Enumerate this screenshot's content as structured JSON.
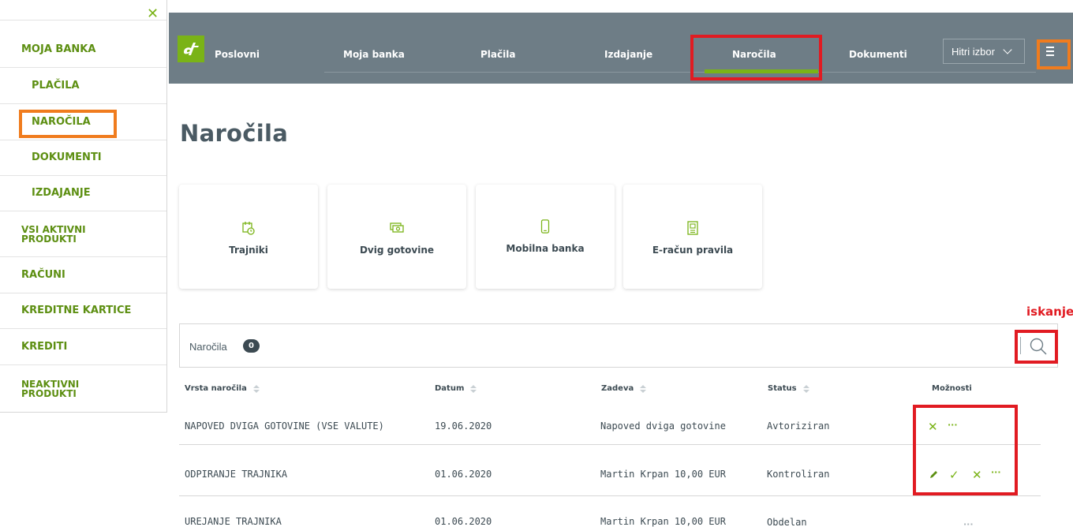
{
  "drawer": {
    "items": [
      {
        "label": "MOJA BANKA"
      },
      {
        "label": "PLAČILA"
      },
      {
        "label": "NAROČILA"
      },
      {
        "label": "DOKUMENTI"
      },
      {
        "label": "IZDAJANJE"
      },
      {
        "label_line1": "VSI AKTIVNI",
        "label_line2": "PRODUKTI"
      },
      {
        "label": "RAČUNI"
      },
      {
        "label": "KREDITNE KARTICE"
      },
      {
        "label": "KREDITI"
      },
      {
        "label_line1": "NEAKTIVNI",
        "label_line2": "PRODUKTI"
      }
    ]
  },
  "header": {
    "brand": "Poslovni",
    "nav": [
      "Moja banka",
      "Plačila",
      "Izdajanje",
      "Naročila",
      "Dokumenti"
    ],
    "active_nav": "Naročila",
    "quick_select": "Hitri izbor"
  },
  "page": {
    "title": "Naročila",
    "tiles": [
      {
        "label": "Trajniki",
        "icon": "calendar-clock-icon"
      },
      {
        "label": "Dvig gotovine",
        "icon": "cash-icon"
      },
      {
        "label": "Mobilna banka",
        "icon": "mobile-phone-icon"
      },
      {
        "label": "E-račun pravila",
        "icon": "document-rules-icon"
      }
    ],
    "search_annotation": "iskanje"
  },
  "orders": {
    "title": "Naročila",
    "count": "0",
    "columns": [
      "Vrsta naročila",
      "Datum",
      "Zadeva",
      "Status",
      "Možnosti"
    ],
    "rows": [
      {
        "type": "NAPOVED DVIGA GOTOVINE (VSE VALUTE)",
        "date": "19.06.2020",
        "subject": "Napoved dviga gotovine",
        "status": "Avtoriziran",
        "actions": [
          "cancel",
          "more"
        ]
      },
      {
        "type": "ODPIRANJE TRAJNIKA",
        "date": "01.06.2020",
        "subject": "Martin Krpan 10,00 EUR",
        "status": "Kontroliran",
        "actions": [
          "edit",
          "confirm",
          "cancel",
          "more"
        ]
      },
      {
        "type": "UREJANJE TRAJNIKA",
        "date": "01.06.2020",
        "subject": "Martin Krpan 10,00 EUR",
        "status": "Obdelan",
        "actions": [
          "more"
        ]
      }
    ],
    "more_label": "···"
  },
  "colors": {
    "accent_green": "#7ab317",
    "nav_bg": "#6e7d86",
    "highlight_red": "#e11b22",
    "highlight_orange": "#f07c1e"
  }
}
